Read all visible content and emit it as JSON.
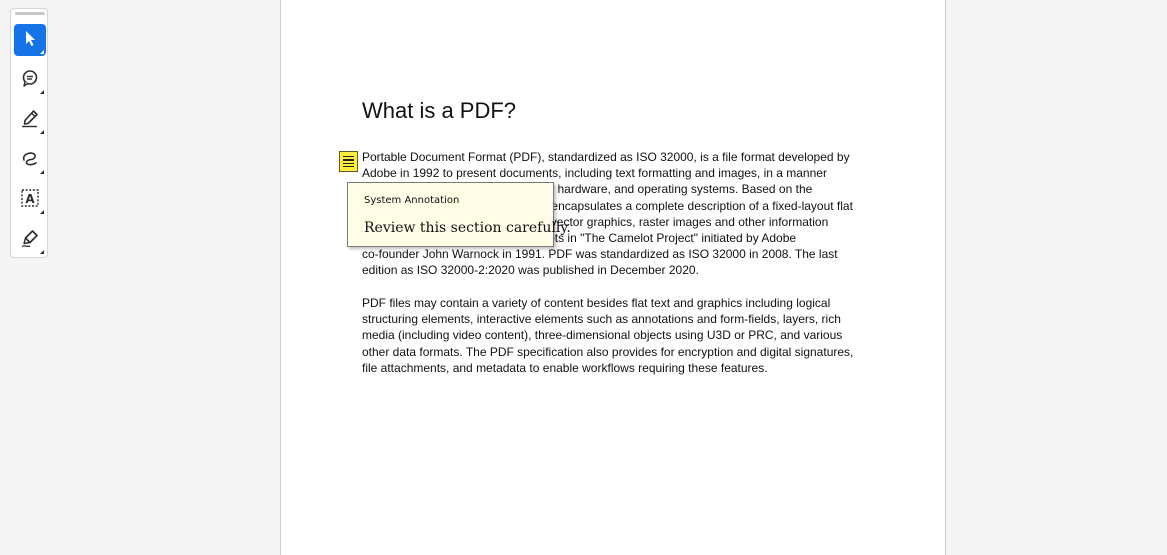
{
  "toolbar": {
    "tools": [
      {
        "name": "select-tool",
        "icon": "pointer-arrow-icon",
        "active": true
      },
      {
        "name": "comment-tool",
        "icon": "comment-bubble-icon",
        "active": false
      },
      {
        "name": "highlight-tool",
        "icon": "pen-icon",
        "active": false
      },
      {
        "name": "draw-tool",
        "icon": "freehand-loop-icon",
        "active": false
      },
      {
        "name": "text-tool",
        "icon": "text-box-icon",
        "active": false
      },
      {
        "name": "sign-tool",
        "icon": "signature-pen-icon",
        "active": false
      }
    ],
    "text_tool_glyph": "A"
  },
  "document": {
    "title": "What is a PDF?",
    "paragraph1_lines": [
      "Portable Document Format (PDF), standardized as ISO 32000, is a file format developed by",
      "Adobe in 1992 to present documents, including text formatting and images, in a manner",
      "independent of application software, hardware, and operating systems. Based on the",
      "PostScript language, each PDF file encapsulates a complete description of a fixed-layout flat",
      "document, including the text, fonts, vector graphics, raster images and other information",
      "needed to display it. PDF has its roots in \"The Camelot Project\" initiated by Adobe",
      "co-founder John Warnock in 1991. PDF was standardized as ISO 32000 in 2008. The last",
      "edition as ISO 32000-2:2020 was published in December 2020."
    ],
    "paragraph2_lines": [
      "PDF files may contain a variety of content besides flat text and graphics including logical",
      "structuring elements, interactive elements such as annotations and form-fields, layers, rich",
      "media (including video content), three-dimensional objects using U3D or PRC, and various",
      "other data formats. The PDF specification also provides for encryption and digital signatures,",
      "file attachments, and metadata to enable workflows requiring these features."
    ]
  },
  "annotation": {
    "author": "System Annotation",
    "text": "Review this section carefully.",
    "note_color": "#ffef3b"
  },
  "colors": {
    "accent": "#1473e6",
    "background": "#f4f4f4",
    "page": "#ffffff",
    "popup_background": "#fffde5"
  }
}
